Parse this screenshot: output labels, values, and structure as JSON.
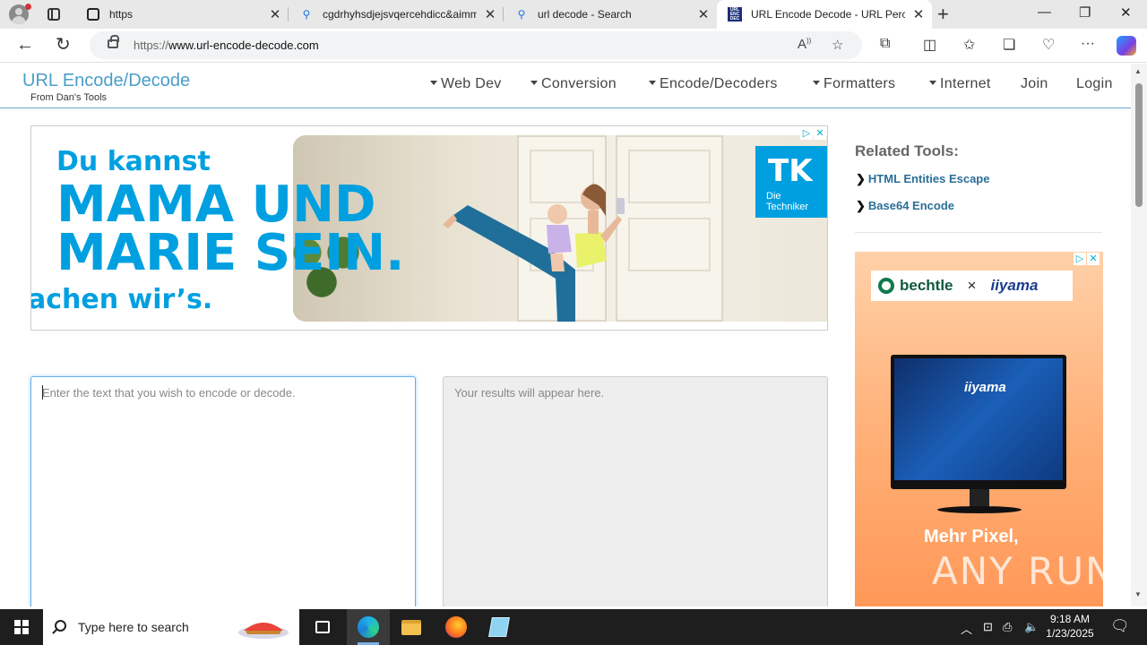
{
  "browser": {
    "tabs": [
      {
        "title": "https",
        "icon": "https-page-icon"
      },
      {
        "title": "cgdrhyhsdjejsvqercehdicc&aimm",
        "icon": "search-icon"
      },
      {
        "title": "url decode - Search",
        "icon": "search-icon"
      },
      {
        "title": "URL Encode Decode - URL Percent",
        "icon": "site-favicon",
        "active": true
      }
    ],
    "favicon_text": "URL ENC DEC",
    "url_prefix": "https://",
    "url_host": "www.url-encode-decode.com"
  },
  "site": {
    "brand": "URL Encode/Decode",
    "brand_sub": "From Dan's Tools",
    "menu": [
      {
        "label": "Web Dev",
        "dropdown": true
      },
      {
        "label": "Conversion",
        "dropdown": true
      },
      {
        "label": "Encode/Decoders",
        "dropdown": true
      },
      {
        "label": "Formatters",
        "dropdown": true
      },
      {
        "label": "Internet",
        "dropdown": true
      },
      {
        "label": "Join",
        "dropdown": false
      },
      {
        "label": "Login",
        "dropdown": false
      }
    ]
  },
  "banner_ad": {
    "line1": "Du kannst",
    "line2": "MAMA UND",
    "line3": "MARIE SEIN.",
    "line4": "achen wir’s.",
    "logo_mark": "TK",
    "logo_name_1": "Die",
    "logo_name_2": "Techniker",
    "accent": "#00a0e0"
  },
  "editor": {
    "input_placeholder": "Enter the text that you wish to encode or decode.",
    "output_placeholder": "Your results will appear here."
  },
  "sidebar": {
    "related_title": "Related Tools:",
    "links": [
      "HTML Entities Escape",
      "Base64 Encode"
    ]
  },
  "side_ad": {
    "brand_left": "bechtle",
    "times": "×",
    "brand_right": "iiyama",
    "screen_brand": "iiyama",
    "headline": "Mehr Pixel,"
  },
  "watermark": "ANY RUN",
  "taskbar": {
    "search_placeholder": "Type here to search",
    "time": "9:18 AM",
    "date": "1/23/2025"
  }
}
